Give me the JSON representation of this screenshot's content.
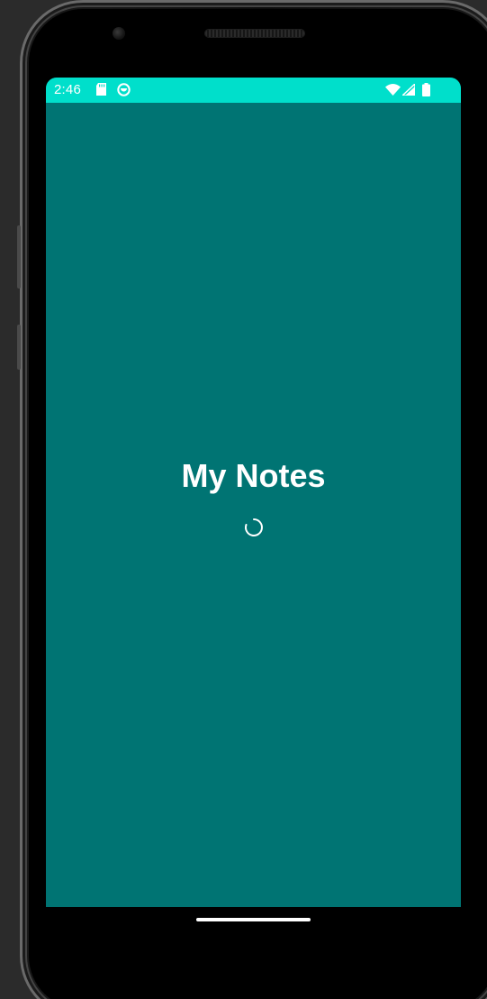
{
  "status_bar": {
    "time": "2:46",
    "icons_left": [
      "sd-card-icon",
      "app-notification-icon"
    ],
    "icons_right": [
      "wifi-icon",
      "cell-signal-icon",
      "battery-icon"
    ]
  },
  "app": {
    "title": "My Notes",
    "loading": true
  },
  "colors": {
    "status_bar": "#00dfcb",
    "background": "#007473",
    "text": "#ffffff"
  }
}
